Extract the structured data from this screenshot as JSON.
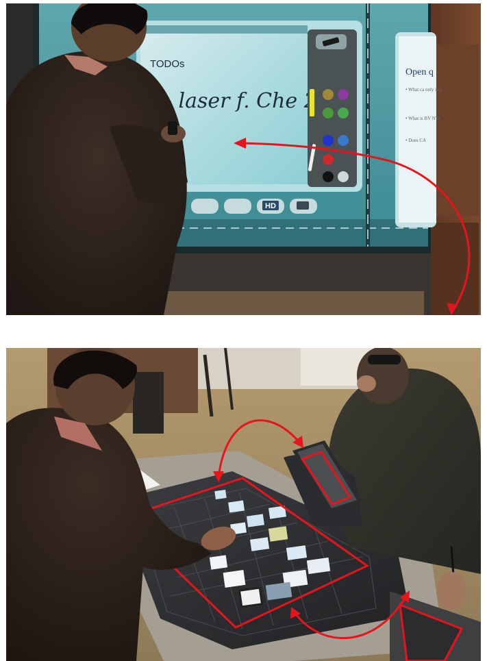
{
  "figure": {
    "panels": [
      {
        "id": "top",
        "scene": "wall-display",
        "whiteboard": {
          "title": "TODOs",
          "handwriting": "— laser f. Che  2x"
        },
        "toolbar": {
          "hd_label": "HD"
        },
        "side_slide": {
          "title": "Open q",
          "bullets": [
            "• What ca only imp",
            "• What is BV NTe",
            "• Does CA"
          ]
        }
      },
      {
        "id": "bottom",
        "scene": "tabletop-and-tablets"
      }
    ],
    "annotation_color": "#e8141c"
  }
}
